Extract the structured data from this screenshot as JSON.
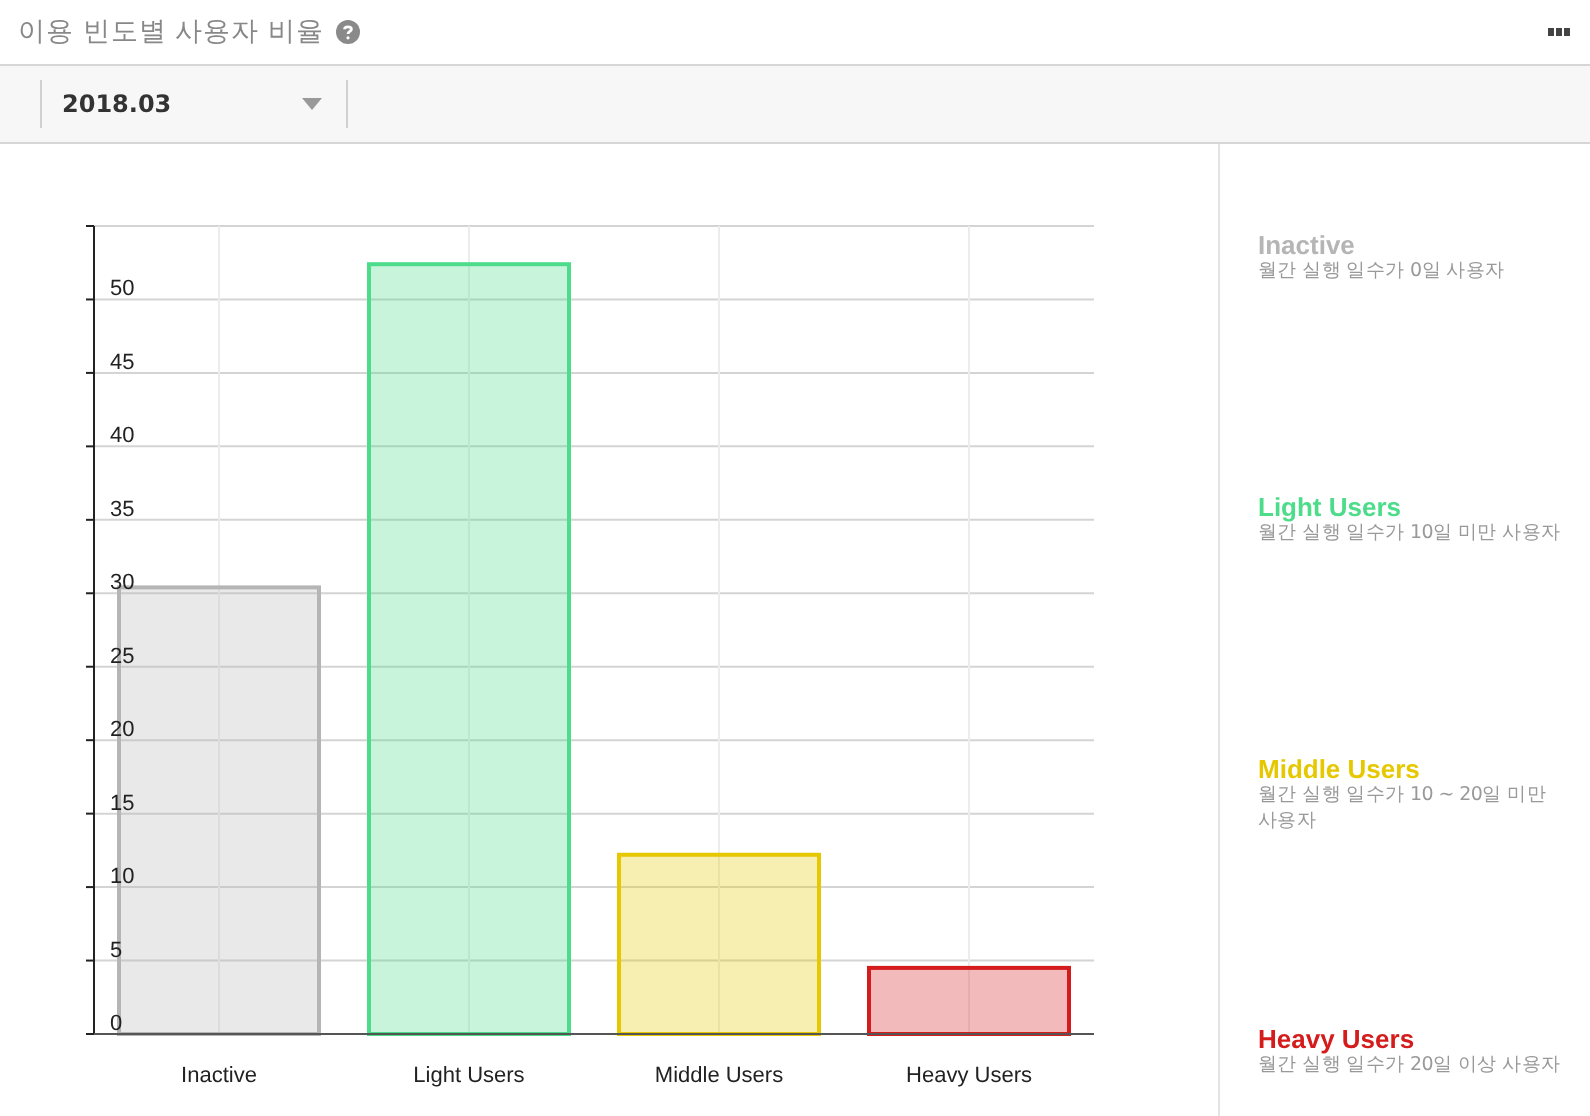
{
  "header": {
    "title": "이용 빈도별 사용자 비율"
  },
  "filter": {
    "month": "2018.03"
  },
  "chart_data": {
    "type": "bar",
    "categories": [
      "Inactive",
      "Light Users",
      "Middle Users",
      "Heavy Users"
    ],
    "values": [
      30.4,
      52.4,
      12.2,
      4.5
    ],
    "grid": true,
    "ylim": [
      0,
      55
    ],
    "yticks": [
      0,
      5,
      10,
      15,
      20,
      25,
      30,
      35,
      40,
      45,
      50
    ]
  },
  "legend": [
    {
      "name": "Inactive",
      "description": "월간 실행 일수가 0일 사용자",
      "color": "#b5b5b5"
    },
    {
      "name": "Light Users",
      "description": "월간 실행 일수가 10일 미만 사용자",
      "color": "#4cdc8a"
    },
    {
      "name": "Middle Users",
      "description": "월간 실행 일수가 10 ~ 20일 미만 사용자",
      "color": "#e6c800"
    },
    {
      "name": "Heavy Users",
      "description": "월간 실행 일수가 20일 이상 사용자",
      "color": "#d41c1c"
    }
  ]
}
